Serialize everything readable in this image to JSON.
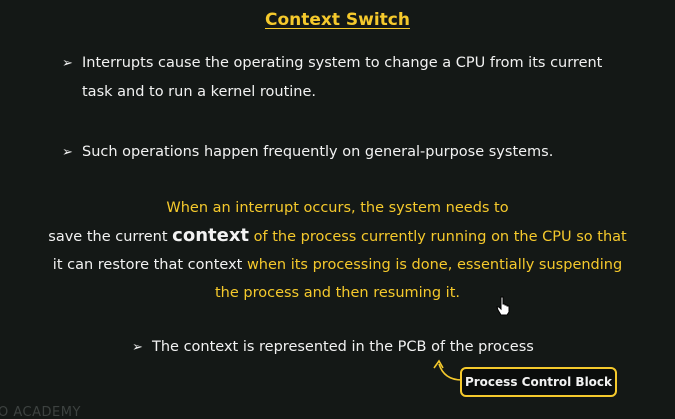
{
  "slide": {
    "title": "Context Switch",
    "bullet_glyph": "➢",
    "bullets": [
      {
        "line1": "Interrupts cause the operating system to change a CPU from its current",
        "line2": "task and to run a kernel routine."
      },
      {
        "line1": "Such operations happen frequently on general-purpose systems."
      },
      {
        "line1": "The context is represented in the PCB of the process"
      }
    ],
    "paragraph": {
      "l1": "When an interrupt occurs, the system needs to",
      "l2a": "save the current ",
      "l2b": "context",
      "l2c": " of the process currently running on the CPU so that",
      "l3a": "it can restore that context",
      "l3b": " when its processing is done, essentially suspending",
      "l4": "the process and then resuming it."
    },
    "callout": {
      "label": "Process Control Block"
    },
    "watermark": "O ACADEMY"
  },
  "colors": {
    "background": "#141816",
    "accent": "#f5c92c",
    "text": "#f2f2f2"
  },
  "icons": {
    "cursor": "hand-pointer-icon",
    "arrow": "curved-arrow-icon"
  }
}
